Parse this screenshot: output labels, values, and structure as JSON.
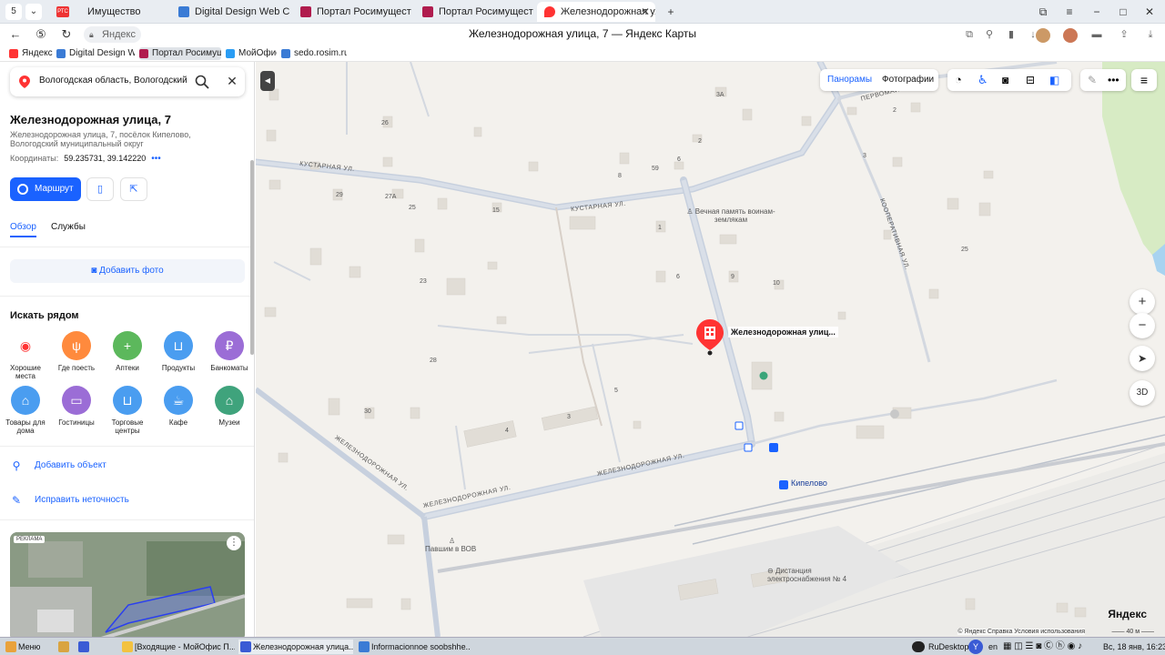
{
  "browser": {
    "tab_counter": "5",
    "tabs": [
      {
        "label": "Имущество",
        "icon_color": "#e33"
      },
      {
        "label": "Digital Design Web Client",
        "icon_color": "#3a7bd5"
      },
      {
        "label": "Портал Росимущества",
        "icon_color": "#b01c4e"
      },
      {
        "label": "Портал Росимущества",
        "icon_color": "#b01c4e"
      },
      {
        "label": "Железнодорожная улица",
        "icon_color": "#f33"
      }
    ],
    "rtc_badge": "РТС",
    "site_chip": "Яндекс",
    "page_title": "Железнодорожная улица, 7 — Яндекс Карты",
    "bookmarks": [
      {
        "label": "Яндекс",
        "icon_color": "#f33"
      },
      {
        "label": "Digital Design Web",
        "icon_color": "#3a7bd5"
      },
      {
        "label": "Портал Росимущ",
        "icon_color": "#b01c4e"
      },
      {
        "label": "МойОфис",
        "icon_color": "#2a9df4"
      },
      {
        "label": "sedo.rosim.ru",
        "icon_color": "#3a7bd5"
      }
    ]
  },
  "sidebar": {
    "search_value": "Вологодская область, Вологодский р",
    "place_title": "Железнодорожная улица, 7",
    "place_address": "Железнодорожная улица, 7, посёлок Кипелово, Вологодский муниципальный округ",
    "coords_label": "Координаты:",
    "coords_value": "59.235731, 39.142220",
    "coords_more": "•••",
    "route_label": "Маршрут",
    "tabs": [
      "Обзор",
      "Службы"
    ],
    "add_photo": "Добавить фото",
    "nearby_title": "Искать рядом",
    "categories": [
      {
        "label": "Хорошие места",
        "color": "#ffffff",
        "glyph": "◉"
      },
      {
        "label": "Где поесть",
        "color": "#ff8a3d",
        "glyph": "ψ"
      },
      {
        "label": "Аптеки",
        "color": "#5cb85c",
        "glyph": "+"
      },
      {
        "label": "Продукты",
        "color": "#4a9df0",
        "glyph": "⊔"
      },
      {
        "label": "Банкоматы",
        "color": "#9b6dd6",
        "glyph": "₽"
      },
      {
        "label": "Товары для дома",
        "color": "#4a9df0",
        "glyph": "⌂"
      },
      {
        "label": "Гостиницы",
        "color": "#9b6dd6",
        "glyph": "▭"
      },
      {
        "label": "Торговые центры",
        "color": "#4a9df0",
        "glyph": "⊔"
      },
      {
        "label": "Кафе",
        "color": "#4a9df0",
        "glyph": "☕"
      },
      {
        "label": "Музеи",
        "color": "#3fa37c",
        "glyph": "⌂"
      }
    ],
    "add_object": "Добавить объект",
    "fix_error": "Исправить неточность",
    "ad_tag": "РЕКЛАМА"
  },
  "map": {
    "panoramas": "Панорамы",
    "photos": "Фотографии",
    "marker_label": "Железнодорожная улиц...",
    "memorial": "Вечная память воинам-землякам",
    "fallen": "Павшим в ВОВ",
    "station": "Кипелово",
    "distance": "Дистанция электроснабжения № 4",
    "streets": {
      "kustarnaya1": "КУСТАРНАЯ УЛ.",
      "kustarnaya2": "КУСТАРНАЯ УЛ.",
      "zhd1": "ЖЕЛЕЗНОДОРОЖНАЯ УЛ.",
      "zhd2": "ЖЕЛЕЗНОДОРОЖНАЯ УЛ.",
      "zhd3": "ЖЕЛЕЗНОДОРОЖНАЯ УЛ.",
      "koop": "КООПЕРАТИВНАЯ УЛ.",
      "perv": "ПЕРВОМАЙСКАЯ"
    },
    "house_numbers": [
      "3А",
      "26",
      "2",
      "6",
      "59",
      "8",
      "29",
      "27А",
      "25",
      "15",
      "1",
      "6",
      "9",
      "10",
      "3",
      "25",
      "23",
      "28",
      "5",
      "30",
      "4",
      "3",
      "2"
    ],
    "zoom_in": "+",
    "zoom_out": "−",
    "btn_3d": "3D",
    "logo": "Яндекс",
    "copyright": "© Яндекс   Справка   Условия использования",
    "scale": "40 м"
  },
  "taskbar": {
    "menu": "Меню",
    "tasks": [
      {
        "label": "[Входящие - МойОфис П...",
        "icon_color": "#f3c240"
      },
      {
        "label": "Железнодорожная улица...",
        "icon_color": "#3a5bd5"
      },
      {
        "label": "Informacionnoe soobshhe...",
        "icon_color": "#3a7bd5"
      }
    ],
    "rudesktop": "RuDesktop",
    "lang": "en",
    "datetime": "Вс, 18 янв, 16:23"
  }
}
